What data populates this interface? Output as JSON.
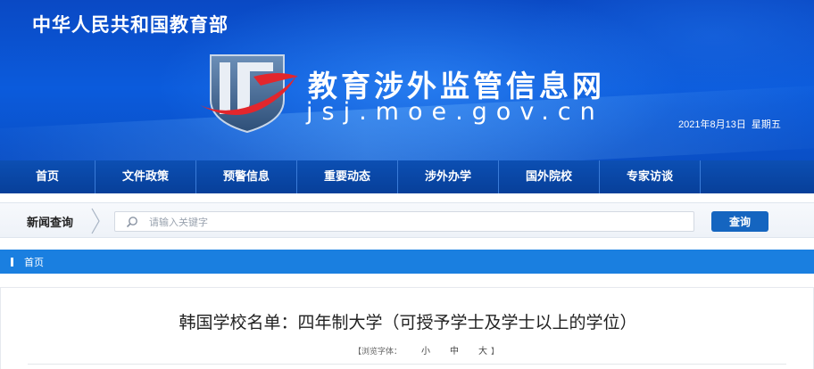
{
  "header": {
    "ministry": "中华人民共和国教育部",
    "site_title": "教育涉外监管信息网",
    "site_url": "jsj.moe.gov.cn",
    "date": "2021年8月13日",
    "weekday": "星期五",
    "logo_icon": "jsj-shield-logo-icon",
    "colors": {
      "banner": "#0b5bdc",
      "nav": "#073f99",
      "logo_red": "#e3262c"
    }
  },
  "nav": {
    "items": [
      {
        "label": "首页"
      },
      {
        "label": "文件政策"
      },
      {
        "label": "预警信息"
      },
      {
        "label": "重要动态"
      },
      {
        "label": "涉外办学"
      },
      {
        "label": "国外院校"
      },
      {
        "label": "专家访谈"
      }
    ]
  },
  "search": {
    "label": "新闻查询",
    "placeholder": "请输入关键字",
    "button": "查询",
    "icon": "search-icon"
  },
  "breadcrumb": {
    "home": "首页",
    "color": "#1a7fe0"
  },
  "article": {
    "title": "韩国学校名单：四年制大学（可授予学士及学士以上的学位）",
    "font_size_label": "【浏览字体：",
    "font_small": "小",
    "font_medium": "中",
    "font_large": "大",
    "font_close": "】"
  }
}
